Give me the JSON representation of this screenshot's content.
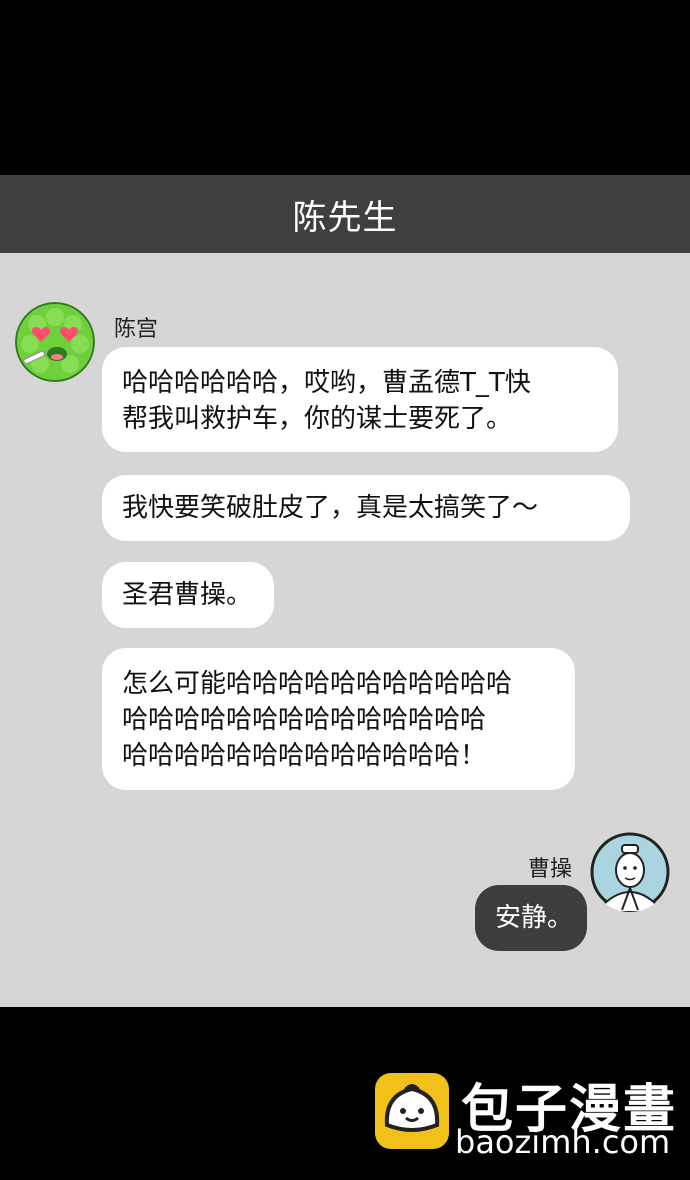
{
  "chat": {
    "title": "陈先生",
    "messages": [
      {
        "sender": "陈宫",
        "avatar_icon": "green-heart-eyes-avatar-icon",
        "bubbles": [
          [
            "哈哈哈哈哈哈，哎哟，曹孟德T_T快",
            "帮我叫救护车，你的谋士要死了。"
          ],
          [
            "我快要笑破肚皮了，真是太搞笑了～"
          ],
          [
            "圣君曹操。"
          ],
          [
            "怎么可能哈哈哈哈哈哈哈哈哈哈哈",
            "哈哈哈哈哈哈哈哈哈哈哈哈哈哈",
            "哈哈哈哈哈哈哈哈哈哈哈哈哈！"
          ]
        ]
      },
      {
        "sender": "曹操",
        "avatar_icon": "ancient-scholar-avatar-icon",
        "bubbles": [
          [
            "安静。"
          ]
        ]
      }
    ]
  },
  "watermark": {
    "title": "包子漫畫",
    "url": "baozimh.com",
    "icon": "baozi-bun-icon"
  },
  "colors": {
    "header_bg": "#3f3f3f",
    "chat_bg": "#d6d6d6",
    "left_bubble": "#ffffff",
    "right_bubble": "#3d3d3d",
    "logo_yellow": "#f1c01a"
  }
}
